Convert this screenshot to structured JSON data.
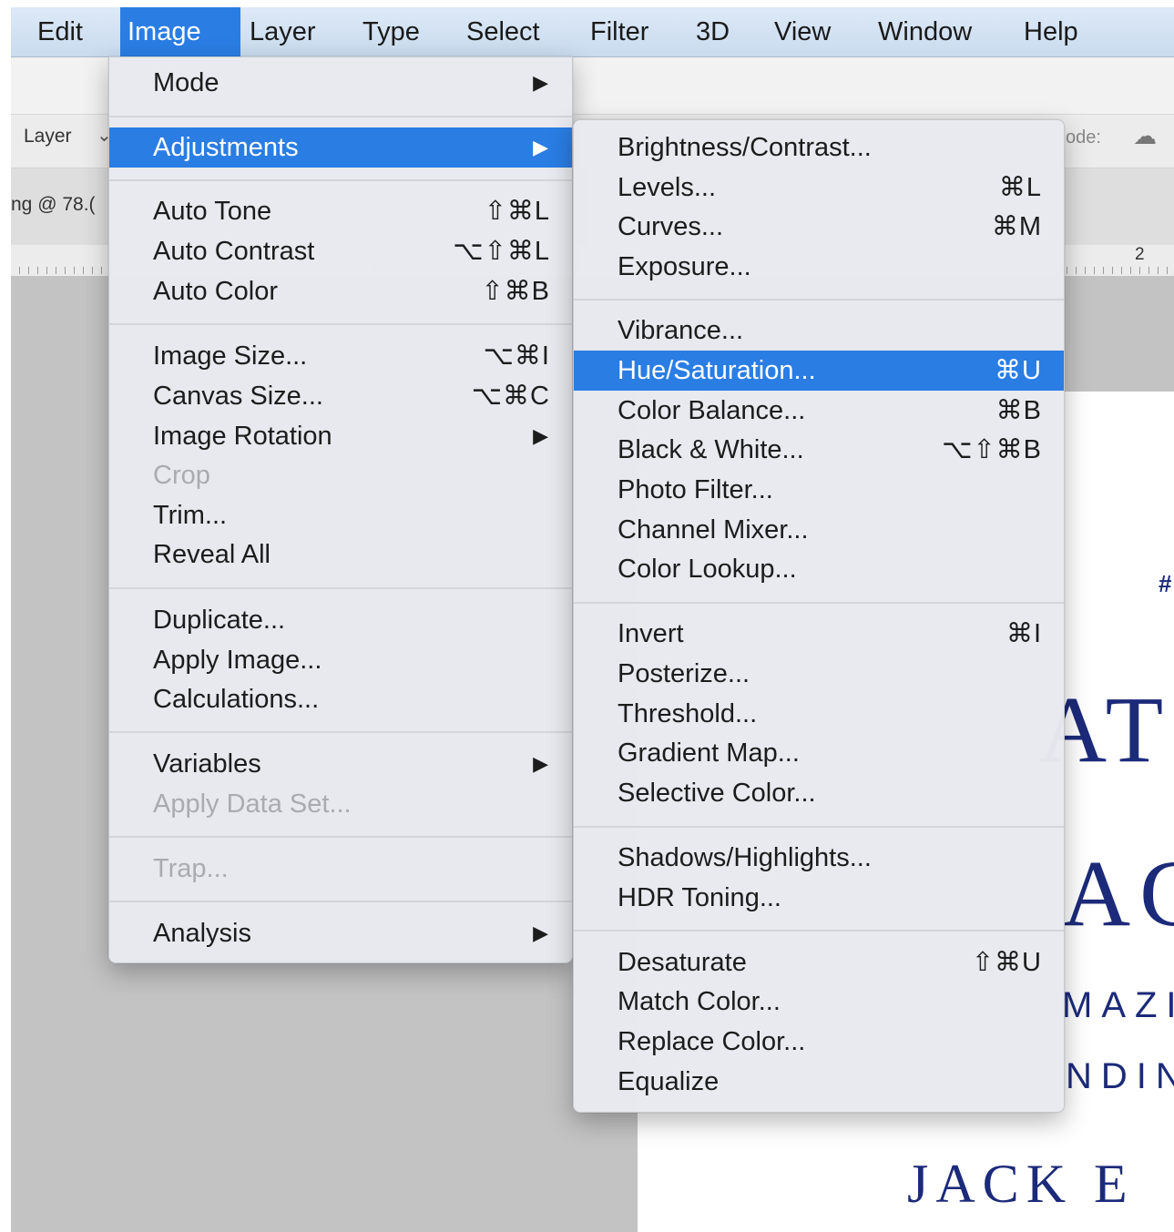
{
  "colors": {
    "highlight": "#2a7de3",
    "menu_bg": "#e8eaef",
    "disabled_text": "#a9abb0",
    "doc_text": "#1c2a7a"
  },
  "menubar": {
    "items": [
      {
        "label": "Edit"
      },
      {
        "label": "Image"
      },
      {
        "label": "Layer"
      },
      {
        "label": "Type"
      },
      {
        "label": "Select"
      },
      {
        "label": "Filter"
      },
      {
        "label": "3D"
      },
      {
        "label": "View"
      },
      {
        "label": "Window"
      },
      {
        "label": "Help"
      }
    ],
    "active": "Image"
  },
  "background": {
    "tool_options_left": "Layer",
    "tool_options_right": "ode:",
    "doc_tab_text": "ng @ 78.(",
    "ruler_label": "2",
    "doc_fragments": [
      "#",
      "AT",
      "AC",
      "MAZI",
      "NDIN",
      "JACK E"
    ]
  },
  "image_menu": {
    "items": [
      {
        "label": "Mode",
        "submenu": true
      },
      {
        "label": "Adjustments",
        "submenu": true,
        "highlighted": true
      },
      {
        "label": "Auto Tone",
        "shortcut": "⇧⌘L"
      },
      {
        "label": "Auto Contrast",
        "shortcut": "⌥⇧⌘L"
      },
      {
        "label": "Auto Color",
        "shortcut": "⇧⌘B"
      },
      {
        "label": "Image Size...",
        "shortcut": "⌥⌘I"
      },
      {
        "label": "Canvas Size...",
        "shortcut": "⌥⌘C"
      },
      {
        "label": "Image Rotation",
        "submenu": true
      },
      {
        "label": "Crop",
        "disabled": true
      },
      {
        "label": "Trim..."
      },
      {
        "label": "Reveal All"
      },
      {
        "label": "Duplicate..."
      },
      {
        "label": "Apply Image..."
      },
      {
        "label": "Calculations..."
      },
      {
        "label": "Variables",
        "submenu": true
      },
      {
        "label": "Apply Data Set...",
        "disabled": true
      },
      {
        "label": "Trap...",
        "disabled": true
      },
      {
        "label": "Analysis",
        "submenu": true
      }
    ]
  },
  "adjustments_menu": {
    "items": [
      {
        "label": "Brightness/Contrast..."
      },
      {
        "label": "Levels...",
        "shortcut": "⌘L"
      },
      {
        "label": "Curves...",
        "shortcut": "⌘M"
      },
      {
        "label": "Exposure..."
      },
      {
        "label": "Vibrance..."
      },
      {
        "label": "Hue/Saturation...",
        "shortcut": "⌘U",
        "highlighted": true
      },
      {
        "label": "Color Balance...",
        "shortcut": "⌘B"
      },
      {
        "label": "Black & White...",
        "shortcut": "⌥⇧⌘B"
      },
      {
        "label": "Photo Filter..."
      },
      {
        "label": "Channel Mixer..."
      },
      {
        "label": "Color Lookup..."
      },
      {
        "label": "Invert",
        "shortcut": "⌘I"
      },
      {
        "label": "Posterize..."
      },
      {
        "label": "Threshold..."
      },
      {
        "label": "Gradient Map..."
      },
      {
        "label": "Selective Color..."
      },
      {
        "label": "Shadows/Highlights..."
      },
      {
        "label": "HDR Toning..."
      },
      {
        "label": "Desaturate",
        "shortcut": "⇧⌘U"
      },
      {
        "label": "Match Color..."
      },
      {
        "label": "Replace Color..."
      },
      {
        "label": "Equalize"
      }
    ]
  }
}
